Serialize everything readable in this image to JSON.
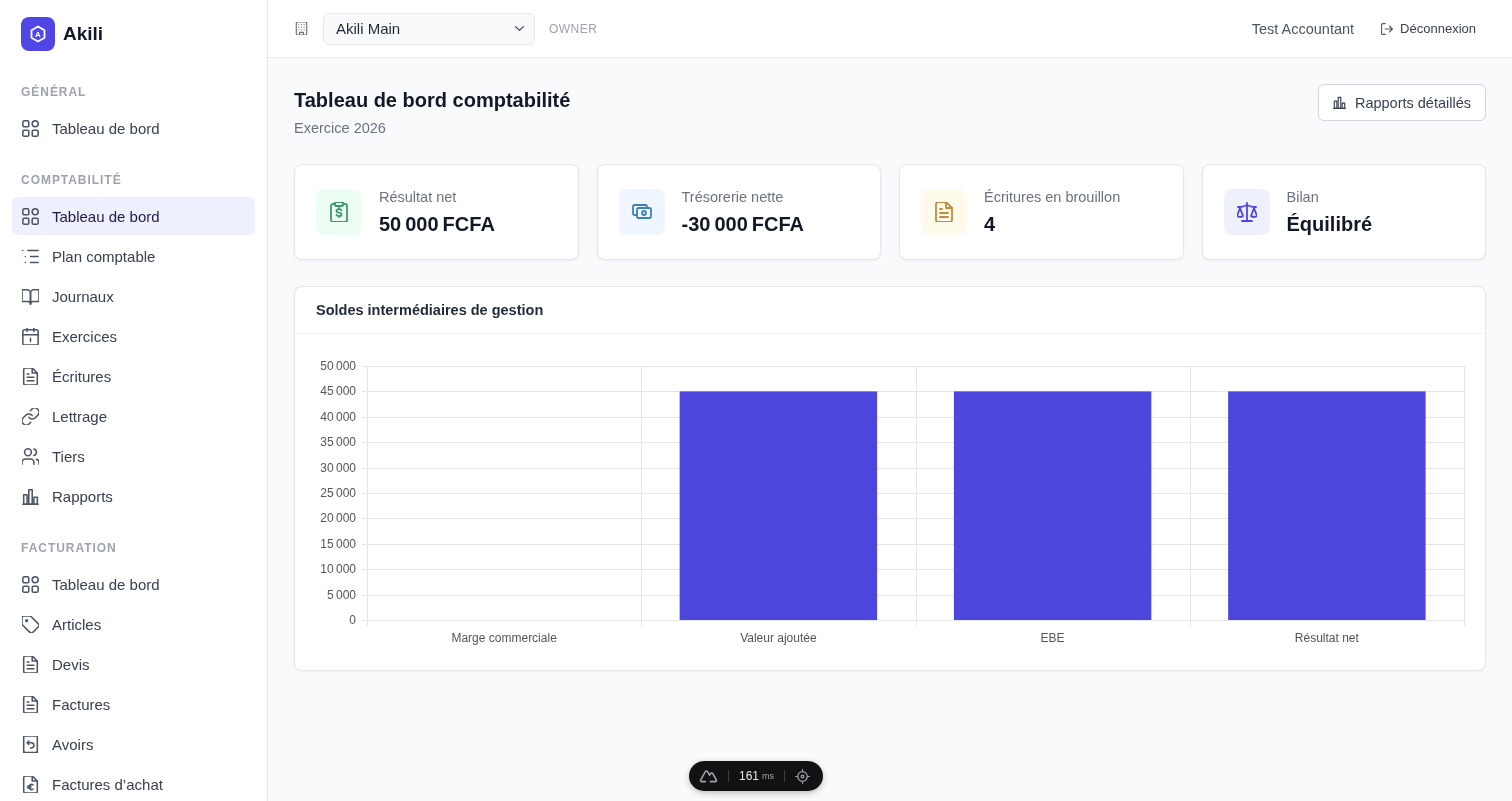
{
  "sidebar": {
    "brand": {
      "mark": "A",
      "name": "Akili"
    },
    "sections": [
      {
        "heading": "GÉNÉRAL",
        "items": [
          {
            "label": "Tableau de bord",
            "selected": false
          }
        ]
      },
      {
        "heading": "COMPTABILITÉ",
        "items": [
          {
            "label": "Tableau de bord",
            "selected": true
          },
          {
            "label": "Plan comptable",
            "selected": false
          },
          {
            "label": "Journaux",
            "selected": false
          },
          {
            "label": "Exercices",
            "selected": false
          },
          {
            "label": "Écritures",
            "selected": false
          },
          {
            "label": "Lettrage",
            "selected": false
          },
          {
            "label": "Tiers",
            "selected": false
          },
          {
            "label": "Rapports",
            "selected": false
          }
        ]
      },
      {
        "heading": "FACTURATION",
        "items": [
          {
            "label": "Tableau de bord",
            "selected": false
          },
          {
            "label": "Articles",
            "selected": false
          },
          {
            "label": "Devis",
            "selected": false
          },
          {
            "label": "Factures",
            "selected": false
          },
          {
            "label": "Avoirs",
            "selected": false
          },
          {
            "label": "Factures d’achat",
            "selected": false
          }
        ]
      }
    ]
  },
  "topbar": {
    "organization_select": {
      "value": "Akili Main"
    },
    "role": "OWNER",
    "user_name": "Test Accountant",
    "logout_button": "Déconnexion"
  },
  "page_header": {
    "title": "Tableau de bord comptabilité",
    "subtitle": "Exercice 2026",
    "reports_button": "Rapports détaillés"
  },
  "kpi_cards": [
    {
      "label": "Résultat net",
      "value": "50 000 FCFA"
    },
    {
      "label": "Trésorerie nette",
      "value": "-30 000 FCFA"
    },
    {
      "label": "Écritures en brouillon",
      "value": "4"
    },
    {
      "label": "Bilan",
      "value": "Équilibré"
    }
  ],
  "chart_card": {
    "title": "Soldes intermédiaires de gestion",
    "chart_data": {
      "type": "bar",
      "categories": [
        "Marge commerciale",
        "Valeur ajoutée",
        "EBE",
        "Résultat net"
      ],
      "values": [
        0,
        45000,
        45000,
        45000
      ],
      "ylim": [
        0,
        50000
      ],
      "yticks": [
        {
          "value": 0,
          "label": "0"
        },
        {
          "value": 5000,
          "label": "5 000"
        },
        {
          "value": 10000,
          "label": "10 000"
        },
        {
          "value": 15000,
          "label": "15 000"
        },
        {
          "value": 20000,
          "label": "20 000"
        },
        {
          "value": 25000,
          "label": "25 000"
        },
        {
          "value": 30000,
          "label": "30 000"
        },
        {
          "value": 35000,
          "label": "35 000"
        },
        {
          "value": 40000,
          "label": "40 000"
        },
        {
          "value": 45000,
          "label": "45 000"
        },
        {
          "value": 50000,
          "label": "50 000"
        }
      ],
      "grid": true
    }
  },
  "devtools_bar": {
    "duration": "161",
    "unit": "ms"
  }
}
